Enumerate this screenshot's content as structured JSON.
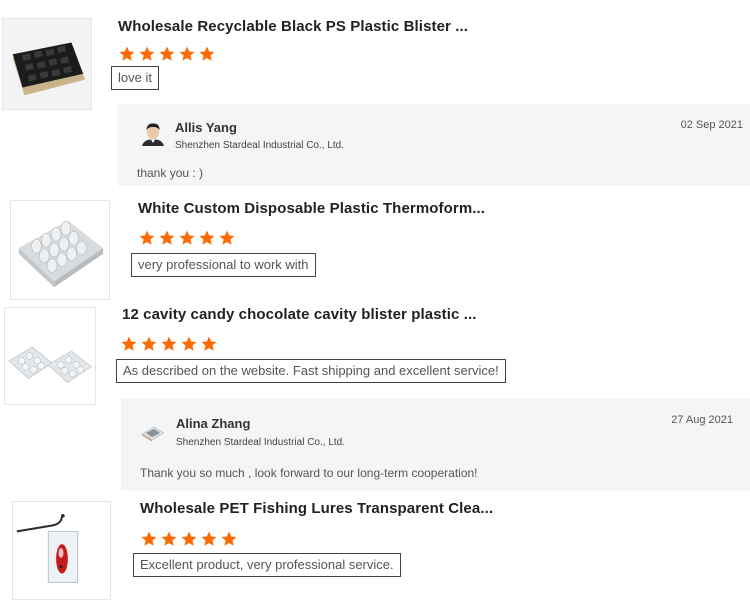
{
  "colors": {
    "star": "#ff6a00",
    "reply_bg": "#f4f5f7"
  },
  "reviews": [
    {
      "title": "Wholesale Recyclable Black PS Plastic Blister ...",
      "rating": 5,
      "comment": "love it",
      "thumb": "black-blister-tray-image"
    },
    {
      "title": "White Custom Disposable Plastic Thermoform...",
      "rating": 5,
      "comment": "very professional to work with",
      "thumb": "white-thermoform-tray-image"
    },
    {
      "title": "12 cavity candy chocolate cavity blister plastic ...",
      "rating": 5,
      "comment": "As described on the website.  Fast shipping and excellent service!",
      "thumb": "clear-chocolate-blister-image"
    },
    {
      "title": "Wholesale PET Fishing Lures Transparent Clea...",
      "rating": 5,
      "comment": "Excellent product, very professional service.",
      "thumb": "fishing-lure-package-image"
    }
  ],
  "replies": [
    {
      "name": "Allis Yang",
      "company": "Shenzhen Stardeal Industrial Co., Ltd.",
      "date": "02 Sep 2021",
      "text": "thank you : )",
      "avatar": "person-avatar"
    },
    {
      "name": "Alina Zhang",
      "company": "Shenzhen Stardeal Industrial Co., Ltd.",
      "date": "27 Aug 2021",
      "text": "Thank you so much , look forward to our long-term cooperation!",
      "avatar": "product-avatar"
    }
  ]
}
